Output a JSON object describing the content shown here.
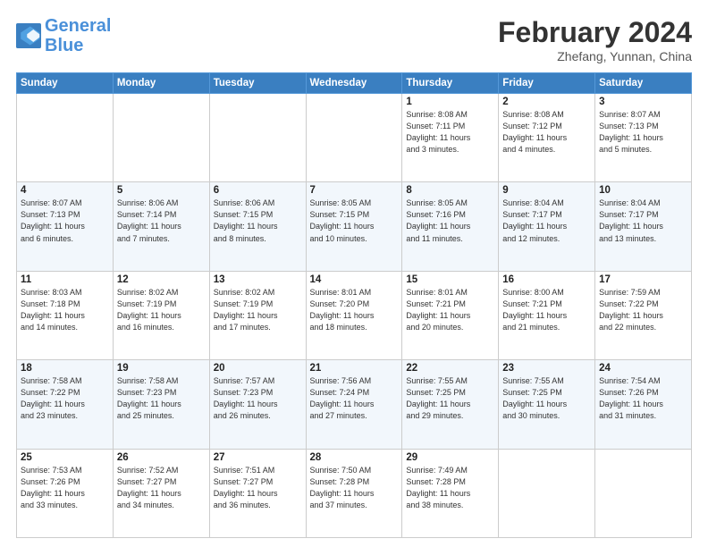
{
  "header": {
    "logo_general": "General",
    "logo_blue": "Blue",
    "month_year": "February 2024",
    "location": "Zhefang, Yunnan, China"
  },
  "weekdays": [
    "Sunday",
    "Monday",
    "Tuesday",
    "Wednesday",
    "Thursday",
    "Friday",
    "Saturday"
  ],
  "weeks": [
    [
      {
        "day": "",
        "info": ""
      },
      {
        "day": "",
        "info": ""
      },
      {
        "day": "",
        "info": ""
      },
      {
        "day": "",
        "info": ""
      },
      {
        "day": "1",
        "info": "Sunrise: 8:08 AM\nSunset: 7:11 PM\nDaylight: 11 hours\nand 3 minutes."
      },
      {
        "day": "2",
        "info": "Sunrise: 8:08 AM\nSunset: 7:12 PM\nDaylight: 11 hours\nand 4 minutes."
      },
      {
        "day": "3",
        "info": "Sunrise: 8:07 AM\nSunset: 7:13 PM\nDaylight: 11 hours\nand 5 minutes."
      }
    ],
    [
      {
        "day": "4",
        "info": "Sunrise: 8:07 AM\nSunset: 7:13 PM\nDaylight: 11 hours\nand 6 minutes."
      },
      {
        "day": "5",
        "info": "Sunrise: 8:06 AM\nSunset: 7:14 PM\nDaylight: 11 hours\nand 7 minutes."
      },
      {
        "day": "6",
        "info": "Sunrise: 8:06 AM\nSunset: 7:15 PM\nDaylight: 11 hours\nand 8 minutes."
      },
      {
        "day": "7",
        "info": "Sunrise: 8:05 AM\nSunset: 7:15 PM\nDaylight: 11 hours\nand 10 minutes."
      },
      {
        "day": "8",
        "info": "Sunrise: 8:05 AM\nSunset: 7:16 PM\nDaylight: 11 hours\nand 11 minutes."
      },
      {
        "day": "9",
        "info": "Sunrise: 8:04 AM\nSunset: 7:17 PM\nDaylight: 11 hours\nand 12 minutes."
      },
      {
        "day": "10",
        "info": "Sunrise: 8:04 AM\nSunset: 7:17 PM\nDaylight: 11 hours\nand 13 minutes."
      }
    ],
    [
      {
        "day": "11",
        "info": "Sunrise: 8:03 AM\nSunset: 7:18 PM\nDaylight: 11 hours\nand 14 minutes."
      },
      {
        "day": "12",
        "info": "Sunrise: 8:02 AM\nSunset: 7:19 PM\nDaylight: 11 hours\nand 16 minutes."
      },
      {
        "day": "13",
        "info": "Sunrise: 8:02 AM\nSunset: 7:19 PM\nDaylight: 11 hours\nand 17 minutes."
      },
      {
        "day": "14",
        "info": "Sunrise: 8:01 AM\nSunset: 7:20 PM\nDaylight: 11 hours\nand 18 minutes."
      },
      {
        "day": "15",
        "info": "Sunrise: 8:01 AM\nSunset: 7:21 PM\nDaylight: 11 hours\nand 20 minutes."
      },
      {
        "day": "16",
        "info": "Sunrise: 8:00 AM\nSunset: 7:21 PM\nDaylight: 11 hours\nand 21 minutes."
      },
      {
        "day": "17",
        "info": "Sunrise: 7:59 AM\nSunset: 7:22 PM\nDaylight: 11 hours\nand 22 minutes."
      }
    ],
    [
      {
        "day": "18",
        "info": "Sunrise: 7:58 AM\nSunset: 7:22 PM\nDaylight: 11 hours\nand 23 minutes."
      },
      {
        "day": "19",
        "info": "Sunrise: 7:58 AM\nSunset: 7:23 PM\nDaylight: 11 hours\nand 25 minutes."
      },
      {
        "day": "20",
        "info": "Sunrise: 7:57 AM\nSunset: 7:23 PM\nDaylight: 11 hours\nand 26 minutes."
      },
      {
        "day": "21",
        "info": "Sunrise: 7:56 AM\nSunset: 7:24 PM\nDaylight: 11 hours\nand 27 minutes."
      },
      {
        "day": "22",
        "info": "Sunrise: 7:55 AM\nSunset: 7:25 PM\nDaylight: 11 hours\nand 29 minutes."
      },
      {
        "day": "23",
        "info": "Sunrise: 7:55 AM\nSunset: 7:25 PM\nDaylight: 11 hours\nand 30 minutes."
      },
      {
        "day": "24",
        "info": "Sunrise: 7:54 AM\nSunset: 7:26 PM\nDaylight: 11 hours\nand 31 minutes."
      }
    ],
    [
      {
        "day": "25",
        "info": "Sunrise: 7:53 AM\nSunset: 7:26 PM\nDaylight: 11 hours\nand 33 minutes."
      },
      {
        "day": "26",
        "info": "Sunrise: 7:52 AM\nSunset: 7:27 PM\nDaylight: 11 hours\nand 34 minutes."
      },
      {
        "day": "27",
        "info": "Sunrise: 7:51 AM\nSunset: 7:27 PM\nDaylight: 11 hours\nand 36 minutes."
      },
      {
        "day": "28",
        "info": "Sunrise: 7:50 AM\nSunset: 7:28 PM\nDaylight: 11 hours\nand 37 minutes."
      },
      {
        "day": "29",
        "info": "Sunrise: 7:49 AM\nSunset: 7:28 PM\nDaylight: 11 hours\nand 38 minutes."
      },
      {
        "day": "",
        "info": ""
      },
      {
        "day": "",
        "info": ""
      }
    ]
  ]
}
